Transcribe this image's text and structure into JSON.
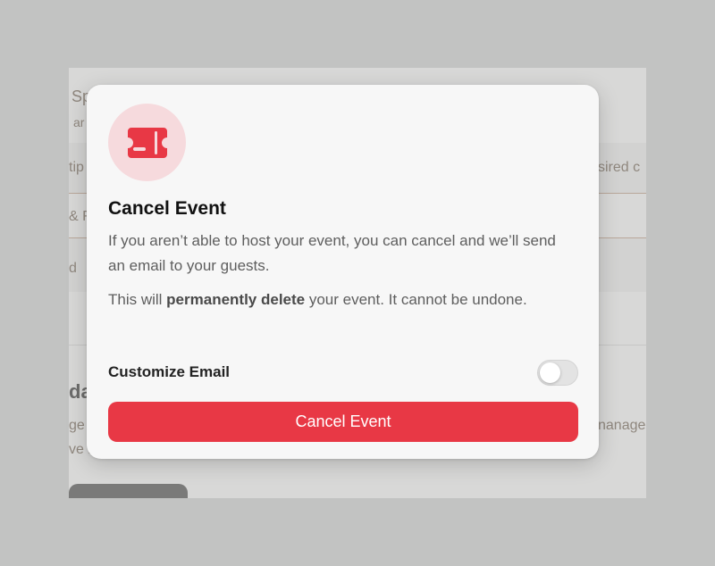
{
  "background": {
    "fragments": {
      "header_title": "Sp",
      "header_sub": "ar",
      "row1_left": "tip",
      "row1_right": "sired c",
      "row2_left": "& F",
      "row3_left": "d",
      "section_title": "da",
      "desc_line1_left": "ge",
      "desc_line1_right": "nanage",
      "desc_line2_left": "ve r"
    }
  },
  "modal": {
    "icon": "ticket-icon",
    "title": "Cancel Event",
    "paragraph1": "If you aren’t able to host your event, you can cancel and we’ll send an email to your guests.",
    "paragraph2_before": "This will ",
    "paragraph2_bold": "permanently delete",
    "paragraph2_after": " your event. It cannot be undone.",
    "customize_email_label": "Customize Email",
    "customize_email_enabled": false,
    "cancel_button_label": "Cancel Event",
    "colors": {
      "accent": "#e83845",
      "icon_circle": "#f6dadd"
    }
  }
}
